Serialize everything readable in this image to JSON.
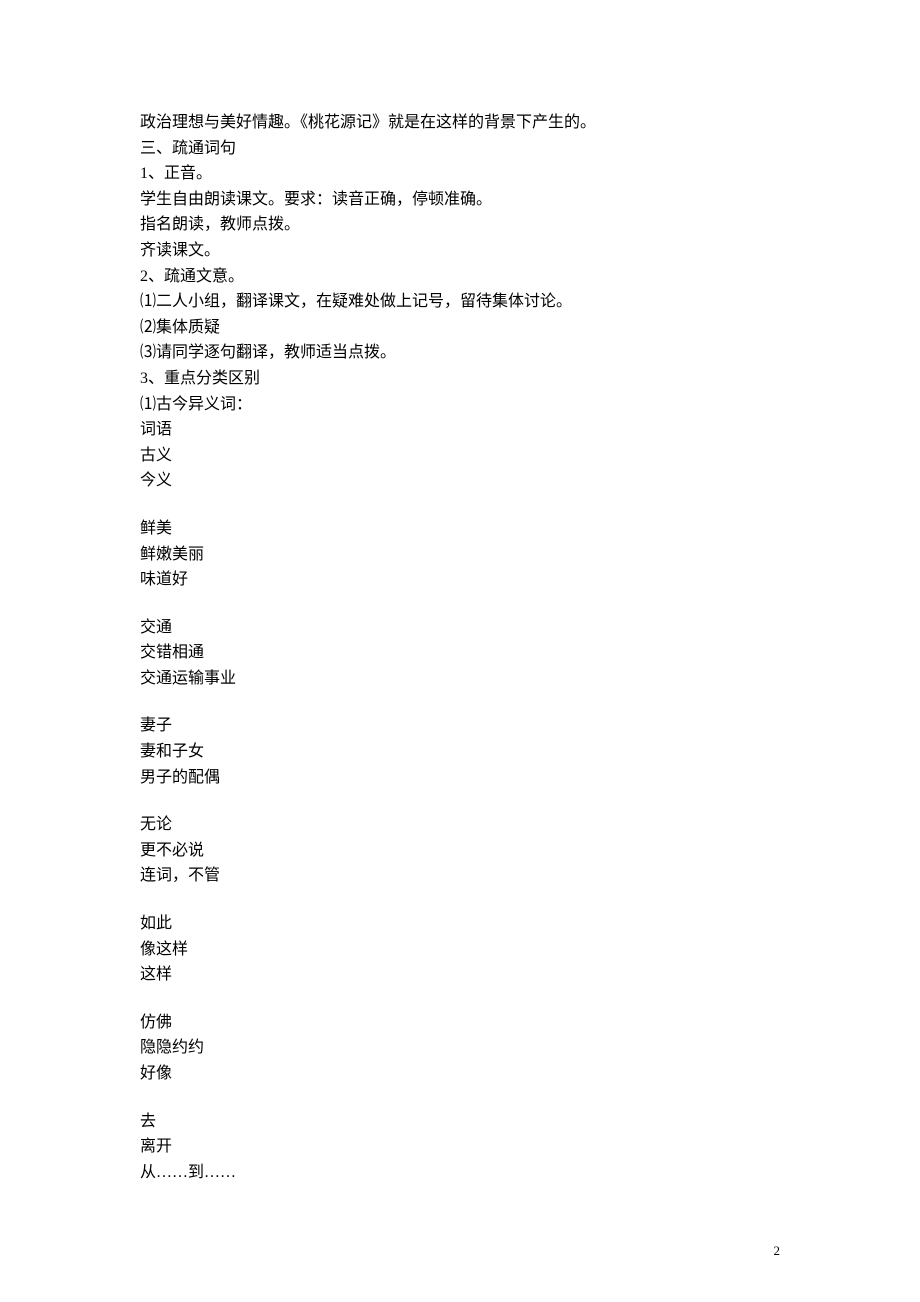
{
  "lines": {
    "l1": "政治理想与美好情趣。《桃花源记》就是在这样的背景下产生的。",
    "l2": "三、疏通词句",
    "l3": "1、正音。",
    "l4": "学生自由朗读课文。要求：读音正确，停顿准确。",
    "l5": "指名朗读，教师点拨。",
    "l6": "齐读课文。",
    "l7": "2、疏通文意。",
    "l8": "⑴二人小组，翻译课文，在疑难处做上记号，留待集体讨论。",
    "l9": "⑵集体质疑",
    "l10": "⑶请同学逐句翻译，教师适当点拨。",
    "l11": "3、重点分类区别",
    "l12": "⑴古今异义词：",
    "l13": "词语",
    "l14": "  古义",
    "l15": "  今义"
  },
  "words": {
    "w1": {
      "term": "鲜美",
      "ancient": "  鲜嫩美丽",
      "modern": "  味道好"
    },
    "w2": {
      "term": "交通",
      "ancient": "  交错相通",
      "modern": "  交通运输事业"
    },
    "w3": {
      "term": "妻子",
      "ancient": "  妻和子女",
      "modern": "  男子的配偶"
    },
    "w4": {
      "term": "无论",
      "ancient": "  更不必说",
      "modern": "  连词，不管"
    },
    "w5": {
      "term": "如此",
      "ancient": "  像这样",
      "modern": "  这样"
    },
    "w6": {
      "term": "仿佛",
      "ancient": "  隐隐约约",
      "modern": "  好像"
    },
    "w7": {
      "term": "去",
      "ancient": "  离开",
      "modern": "  从……到……"
    }
  },
  "page_number": "2"
}
